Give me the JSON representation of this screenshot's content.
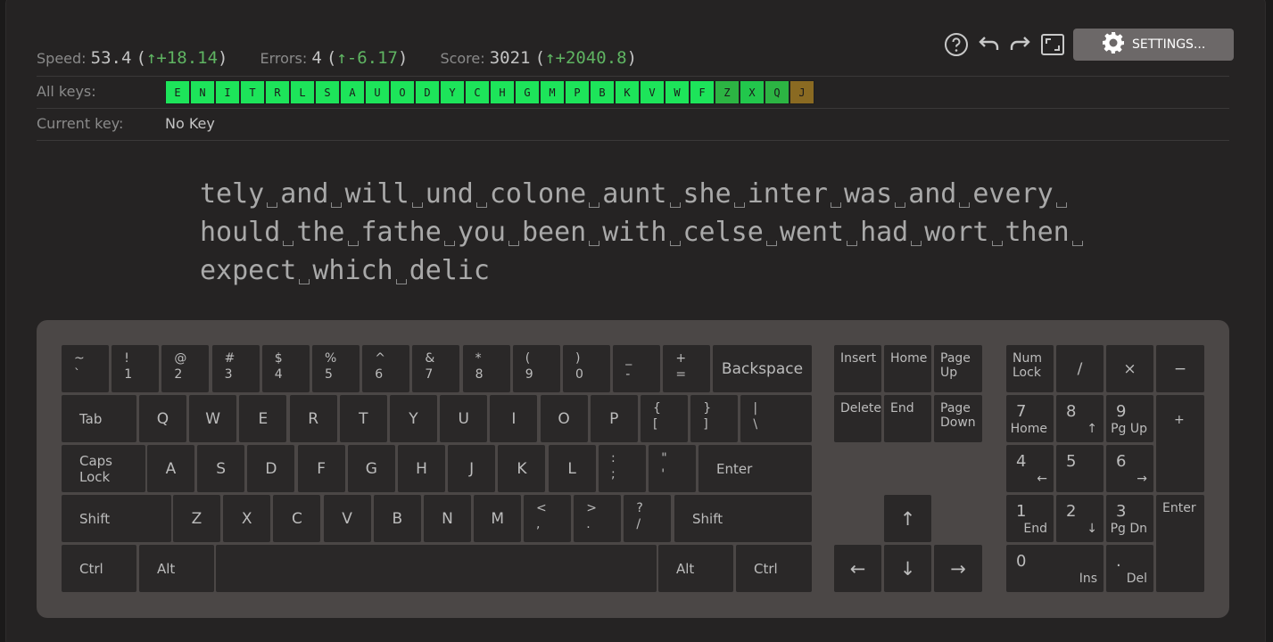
{
  "toolbar": {
    "icons": [
      "help-icon",
      "undo-icon",
      "redo-icon",
      "fullscreen-icon",
      "gear-icon"
    ],
    "settings_label": "SETTINGS..."
  },
  "stats": {
    "speed": {
      "label": "Speed:",
      "value": "53.4",
      "delta": "+18.14"
    },
    "errors": {
      "label": "Errors:",
      "value": "4",
      "delta": "-6.17"
    },
    "score": {
      "label": "Score:",
      "value": "3021",
      "delta": "+2040.8"
    }
  },
  "all_keys": {
    "label": "All keys:",
    "letters": [
      {
        "ch": "E",
        "color": "#1de45a"
      },
      {
        "ch": "N",
        "color": "#1de45a"
      },
      {
        "ch": "I",
        "color": "#1de45a"
      },
      {
        "ch": "T",
        "color": "#1de45a"
      },
      {
        "ch": "R",
        "color": "#1de45a"
      },
      {
        "ch": "L",
        "color": "#1de45a"
      },
      {
        "ch": "S",
        "color": "#1de45a"
      },
      {
        "ch": "A",
        "color": "#1de45a"
      },
      {
        "ch": "U",
        "color": "#1de45a"
      },
      {
        "ch": "O",
        "color": "#1de45a"
      },
      {
        "ch": "D",
        "color": "#1de45a"
      },
      {
        "ch": "Y",
        "color": "#1de45a"
      },
      {
        "ch": "C",
        "color": "#1de45a"
      },
      {
        "ch": "H",
        "color": "#1de45a"
      },
      {
        "ch": "G",
        "color": "#1de45a"
      },
      {
        "ch": "M",
        "color": "#1de45a"
      },
      {
        "ch": "P",
        "color": "#1de45a"
      },
      {
        "ch": "B",
        "color": "#1de45a"
      },
      {
        "ch": "K",
        "color": "#1de45a"
      },
      {
        "ch": "V",
        "color": "#1de45a"
      },
      {
        "ch": "W",
        "color": "#1de45a"
      },
      {
        "ch": "F",
        "color": "#1de45a"
      },
      {
        "ch": "Z",
        "color": "#2cb443"
      },
      {
        "ch": "X",
        "color": "#22c74c"
      },
      {
        "ch": "Q",
        "color": "#2cb443"
      },
      {
        "ch": "J",
        "color": "#8a6a22"
      }
    ]
  },
  "current_key": {
    "label": "Current key:",
    "value": "No Key"
  },
  "text_lines": [
    [
      "tely",
      "and",
      "will",
      "und",
      "colone",
      "aunt",
      "she",
      "inter",
      "was",
      "and",
      "every",
      ""
    ],
    [
      "hould",
      "the",
      "fathe",
      "you",
      "been",
      "with",
      "celse",
      "went",
      "had",
      "wort",
      "then",
      ""
    ],
    [
      "expect",
      "which",
      "delic"
    ]
  ],
  "keyboard": {
    "number_row": [
      {
        "top": "~",
        "bottom": "`"
      },
      {
        "top": "!",
        "bottom": "1"
      },
      {
        "top": "@",
        "bottom": "2"
      },
      {
        "top": "#",
        "bottom": "3"
      },
      {
        "top": "$",
        "bottom": "4"
      },
      {
        "top": "%",
        "bottom": "5"
      },
      {
        "top": "^",
        "bottom": "6"
      },
      {
        "top": "&",
        "bottom": "7"
      },
      {
        "top": "*",
        "bottom": "8"
      },
      {
        "top": "(",
        "bottom": "9"
      },
      {
        "top": ")",
        "bottom": "0"
      },
      {
        "top": "_",
        "bottom": "-"
      },
      {
        "top": "+",
        "bottom": "="
      }
    ],
    "backspace": "Backspace",
    "tab": "Tab",
    "row_q": [
      "Q",
      "W",
      "E",
      "R",
      "T",
      "Y",
      "U",
      "I",
      "O",
      "P"
    ],
    "row_q_sym": [
      {
        "top": "{",
        "bottom": "["
      },
      {
        "top": "}",
        "bottom": "]"
      },
      {
        "top": "|",
        "bottom": "\\"
      }
    ],
    "caps": "Caps Lock",
    "row_a": [
      "A",
      "S",
      "D",
      "F",
      "G",
      "H",
      "J",
      "K",
      "L"
    ],
    "row_a_sym": [
      {
        "top": ":",
        "bottom": ";"
      },
      {
        "top": "\"",
        "bottom": "'"
      }
    ],
    "enter": "Enter",
    "shift": "Shift",
    "row_z": [
      "Z",
      "X",
      "C",
      "V",
      "B",
      "N",
      "M"
    ],
    "row_z_sym": [
      {
        "top": "<",
        "bottom": ","
      },
      {
        "top": ">",
        "bottom": "."
      },
      {
        "top": "?",
        "bottom": "/"
      }
    ],
    "ctrl": "Ctrl",
    "alt": "Alt",
    "nav": {
      "insert": "Insert",
      "home": "Home",
      "page_up": "Page Up",
      "delete": "Delete",
      "end": "End",
      "page_down": "Page Down",
      "arrow_up": "↑",
      "arrow_left": "←",
      "arrow_down": "↓",
      "arrow_right": "→"
    },
    "numpad": {
      "num_lock": "Num Lock",
      "divide": "/",
      "multiply": "×",
      "minus": "−",
      "plus": "+",
      "enter": "Enter",
      "k7": {
        "big": "7",
        "sub": "Home"
      },
      "k8": {
        "big": "8",
        "sub": "↑"
      },
      "k9": {
        "big": "9",
        "sub": "Pg Up"
      },
      "k4": {
        "big": "4",
        "sub": "←"
      },
      "k5": {
        "big": "5",
        "sub": ""
      },
      "k6": {
        "big": "6",
        "sub": "→"
      },
      "k1": {
        "big": "1",
        "sub": "End"
      },
      "k2": {
        "big": "2",
        "sub": "↓"
      },
      "k3": {
        "big": "3",
        "sub": "Pg Dn"
      },
      "k0": {
        "big": "0",
        "sub": "Ins"
      },
      "kdot": {
        "big": ".",
        "sub": "Del"
      }
    }
  }
}
